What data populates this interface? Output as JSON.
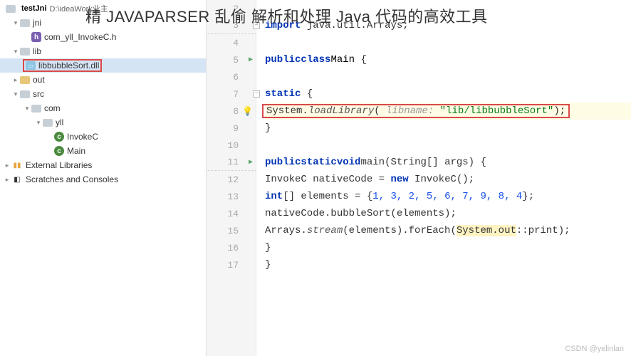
{
  "breadcrumb": {
    "project": "testJni",
    "path": "D:\\ideaWork业主"
  },
  "tree": {
    "jni": "jni",
    "jni_h": "com_yll_InvokeC.h",
    "lib": "lib",
    "lib_dll": "libbubbleSort.dll",
    "out": "out",
    "src": "src",
    "com": "com",
    "yll": "yll",
    "invokec": "InvokeC",
    "main": "Main",
    "ext": "External Libraries",
    "scratch": "Scratches and Consoles"
  },
  "overlay": "精 JAVAPARSER 乱偷    解析和处理 Java 代码的高效工具",
  "watermark": "CSDN @yelinlan",
  "gutter": [
    "2",
    "3",
    "4",
    "5",
    "6",
    "7",
    "8",
    "9",
    "10",
    "11",
    "12",
    "13",
    "14",
    "15",
    "16",
    "17"
  ],
  "code": {
    "l3": {
      "kw": "import",
      "body": " java.util.Arrays;"
    },
    "l5": {
      "kw1": "public",
      "kw2": "class",
      "cls": "Main",
      "br": " {"
    },
    "l7": {
      "kw": "static",
      "br": " {"
    },
    "l8": {
      "call": "System.",
      "fn": "loadLibrary",
      "open": "( ",
      "param": "libname:",
      "str": "\"lib/libbubbleSort\"",
      "close": ");"
    },
    "l9": {
      "br": "}"
    },
    "l11": {
      "kw1": "public",
      "kw2": "static",
      "kw3": "void",
      "fn": "main",
      "args": "(String[] args) {"
    },
    "l12": {
      "lhs": "InvokeC nativeCode = ",
      "kw": "new",
      "rhs": " InvokeC();"
    },
    "l13": {
      "kw": "int",
      "suf": "[] elements = {",
      "nums": "1, 3, 2, 5, 6, 7, 9, 8, 4",
      "close": "};"
    },
    "l14": {
      "body": "nativeCode.bubbleSort(elements);"
    },
    "l15": {
      "a": "Arrays.",
      "fn": "stream",
      "b": "(elements).forEach(",
      "hint": "System.out",
      "c": "::print);"
    },
    "l16": {
      "br": "}"
    },
    "l17": {
      "br": "}"
    }
  }
}
